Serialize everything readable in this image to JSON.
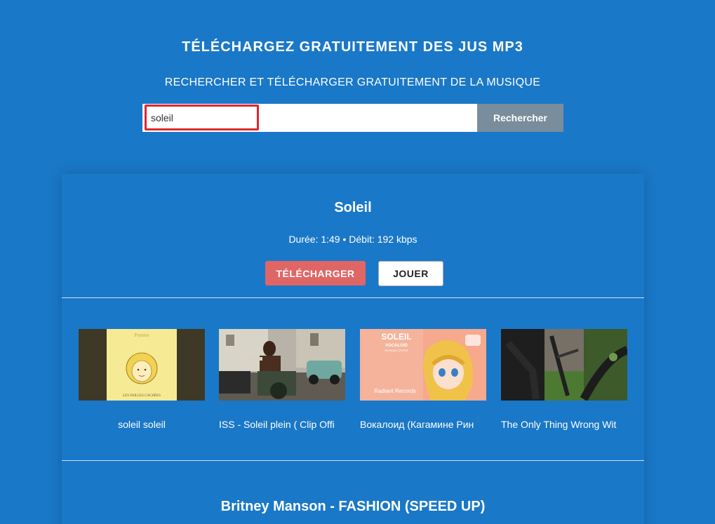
{
  "header": {
    "title": "TÉLÉCHARGEZ GRATUITEMENT DES JUS MP3",
    "subtitle": "RECHERCHER ET TÉLÉCHARGER GRATUITEMENT DE LA MUSIQUE"
  },
  "search": {
    "value": "soleil",
    "button_label": "Rechercher"
  },
  "result": {
    "title": "Soleil",
    "meta": "Durée: 1:49 • Débit: 192 kbps",
    "download_label": "TÉLÉCHARGER",
    "play_label": "JOUER"
  },
  "related": [
    {
      "label": "soleil soleil",
      "thumb": "album-cover-pomme-icon",
      "thumb_text_top": "Pomme",
      "thumb_text_bottom": "LES FAILLES CACHÉES"
    },
    {
      "label": "ISS - Soleil plein ( Clip Offi",
      "thumb": "video-still-street-icon"
    },
    {
      "label": "Вокалоид (Кагамине Рин",
      "thumb": "vocaloid-cover-icon",
      "thumb_text_top": "SOLEIL",
      "thumb_text_mid": "VOCALOID",
      "thumb_text_sub": "RUSSIAN COVER",
      "thumb_text_bottom": "Radiant Records"
    },
    {
      "label": "The Only Thing Wrong Wit",
      "thumb": "motorcycle-still-icon"
    }
  ],
  "next_result": {
    "title": "Britney Manson - FASHION (SPEED UP)"
  },
  "colors": {
    "background": "#1a78c8",
    "download_button": "#e06666",
    "search_button": "#7a8d9c",
    "highlight_border": "#e0262c"
  }
}
